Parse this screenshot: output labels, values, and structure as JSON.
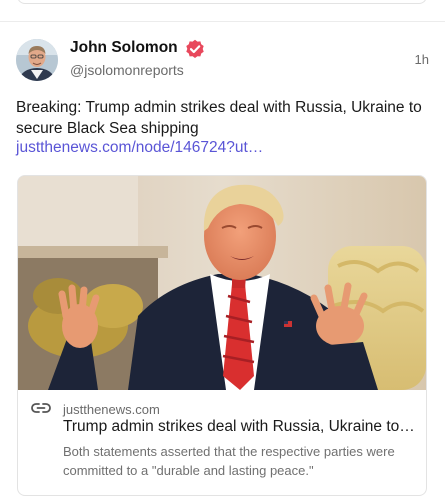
{
  "post": {
    "author_name": "John Solomon",
    "handle": "@jsolomonreports",
    "timestamp": "1h",
    "text": "Breaking: Trump admin strikes deal with Russia, Ukraine to secure Black Sea shipping",
    "link_text": "justthenews.com/node/146724?ut…"
  },
  "link_card": {
    "domain": "justthenews.com",
    "title": "Trump admin strikes deal with Russia, Ukraine to secure Black Sea shipping",
    "description": "Both statements asserted that the respective parties were committed to a \"durable and lasting peace.\""
  },
  "icons": {
    "verified": "verified-badge-icon",
    "link": "link-chain-icon"
  },
  "colors": {
    "link": "#5a55d6",
    "verified": "#e8485c"
  }
}
